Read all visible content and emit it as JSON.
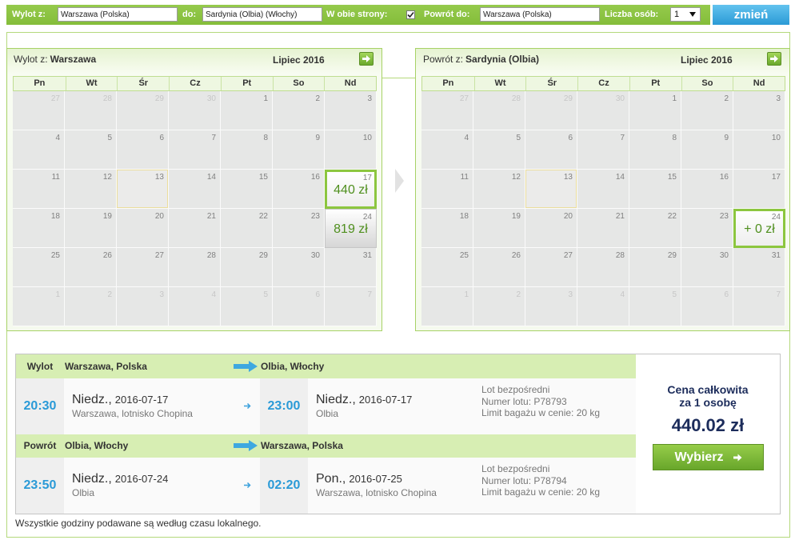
{
  "search": {
    "from_label": "Wylot z:",
    "from_value": "Warszawa (Polska)",
    "to_label": "do:",
    "to_value": "Sardynia (Olbia) (Włochy)",
    "roundtrip_label": "W obie strony:",
    "roundtrip_checked": true,
    "return_label": "Powrót do:",
    "return_value": "Warszawa (Polska)",
    "persons_label": "Liczba osób:",
    "persons_value": "1",
    "submit_label": "zmień"
  },
  "calendars": [
    {
      "title_prefix": "Wylot z:",
      "title_city": "Warszawa",
      "month": "Lipiec 2016",
      "weekdays": [
        "Pn",
        "Wt",
        "Śr",
        "Cz",
        "Pt",
        "So",
        "Nd"
      ],
      "weeks": [
        [
          {
            "d": "27",
            "other": true
          },
          {
            "d": "28",
            "other": true
          },
          {
            "d": "29",
            "other": true
          },
          {
            "d": "30",
            "other": true
          },
          {
            "d": "1"
          },
          {
            "d": "2"
          },
          {
            "d": "3"
          }
        ],
        [
          {
            "d": "4"
          },
          {
            "d": "5"
          },
          {
            "d": "6"
          },
          {
            "d": "7"
          },
          {
            "d": "8"
          },
          {
            "d": "9"
          },
          {
            "d": "10"
          }
        ],
        [
          {
            "d": "11"
          },
          {
            "d": "12"
          },
          {
            "d": "13",
            "today": true
          },
          {
            "d": "14"
          },
          {
            "d": "15"
          },
          {
            "d": "16"
          },
          {
            "d": "17",
            "price": "440 zł",
            "selected": true
          }
        ],
        [
          {
            "d": "18"
          },
          {
            "d": "19"
          },
          {
            "d": "20"
          },
          {
            "d": "21"
          },
          {
            "d": "22"
          },
          {
            "d": "23"
          },
          {
            "d": "24",
            "price": "819 zł"
          }
        ],
        [
          {
            "d": "25"
          },
          {
            "d": "26"
          },
          {
            "d": "27"
          },
          {
            "d": "28"
          },
          {
            "d": "29"
          },
          {
            "d": "30"
          },
          {
            "d": "31"
          }
        ],
        [
          {
            "d": "1",
            "other": true
          },
          {
            "d": "2",
            "other": true
          },
          {
            "d": "3",
            "other": true
          },
          {
            "d": "4",
            "other": true
          },
          {
            "d": "5",
            "other": true
          },
          {
            "d": "6",
            "other": true
          },
          {
            "d": "7",
            "other": true
          }
        ]
      ]
    },
    {
      "title_prefix": "Powrót z:",
      "title_city": "Sardynia (Olbia)",
      "month": "Lipiec 2016",
      "weekdays": [
        "Pn",
        "Wt",
        "Śr",
        "Cz",
        "Pt",
        "So",
        "Nd"
      ],
      "weeks": [
        [
          {
            "d": "27",
            "other": true
          },
          {
            "d": "28",
            "other": true
          },
          {
            "d": "29",
            "other": true
          },
          {
            "d": "30",
            "other": true
          },
          {
            "d": "1"
          },
          {
            "d": "2"
          },
          {
            "d": "3"
          }
        ],
        [
          {
            "d": "4"
          },
          {
            "d": "5"
          },
          {
            "d": "6"
          },
          {
            "d": "7"
          },
          {
            "d": "8"
          },
          {
            "d": "9"
          },
          {
            "d": "10"
          }
        ],
        [
          {
            "d": "11"
          },
          {
            "d": "12"
          },
          {
            "d": "13",
            "today": true
          },
          {
            "d": "14"
          },
          {
            "d": "15"
          },
          {
            "d": "16"
          },
          {
            "d": "17"
          }
        ],
        [
          {
            "d": "18"
          },
          {
            "d": "19"
          },
          {
            "d": "20"
          },
          {
            "d": "21"
          },
          {
            "d": "22"
          },
          {
            "d": "23"
          },
          {
            "d": "24",
            "price": "+ 0 zł",
            "selected": true
          }
        ],
        [
          {
            "d": "25"
          },
          {
            "d": "26"
          },
          {
            "d": "27"
          },
          {
            "d": "28"
          },
          {
            "d": "29"
          },
          {
            "d": "30"
          },
          {
            "d": "31"
          }
        ],
        [
          {
            "d": "1",
            "other": true
          },
          {
            "d": "2",
            "other": true
          },
          {
            "d": "3",
            "other": true
          },
          {
            "d": "4",
            "other": true
          },
          {
            "d": "5",
            "other": true
          },
          {
            "d": "6",
            "other": true
          },
          {
            "d": "7",
            "other": true
          }
        ]
      ]
    }
  ],
  "flights": {
    "legs": [
      {
        "label": "Wylot",
        "from": "Warszawa, Polska",
        "to": "Olbia, Włochy",
        "departure": {
          "time": "20:30",
          "day": "Niedz.,",
          "date": "2016-07-17",
          "place": "Warszawa, lotnisko Chopina"
        },
        "arrival": {
          "time": "23:00",
          "day": "Niedz.,",
          "date": "2016-07-17",
          "place": "Olbia"
        },
        "info": [
          "Lot bezpośredni",
          "Numer lotu: P78793",
          "Limit bagażu w cenie: 20 kg"
        ]
      },
      {
        "label": "Powrót",
        "from": "Olbia, Włochy",
        "to": "Warszawa, Polska",
        "departure": {
          "time": "23:50",
          "day": "Niedz.,",
          "date": "2016-07-24",
          "place": "Olbia"
        },
        "arrival": {
          "time": "02:20",
          "day": "Pon.,",
          "date": "2016-07-25",
          "place": "Warszawa, lotnisko Chopina"
        },
        "info": [
          "Lot bezpośredni",
          "Numer lotu: P78794",
          "Limit bagażu w cenie: 20 kg"
        ]
      }
    ]
  },
  "price": {
    "title": "Cena całkowita",
    "subtitle": "za 1 osobę",
    "amount": "440.02 zł",
    "button": "Wybierz"
  },
  "footer_note": "Wszystkie godziny podawane są według czasu lokalnego.",
  "icons": {
    "next_month": "arrow-right-icon",
    "route": "arrow-right-icon",
    "between_calendars": "chevron-right-icon",
    "checkbox": "check-icon",
    "dropdown": "triangle-down-icon"
  },
  "colors": {
    "brand_green": "#8cc63f",
    "header_green": "#d7eeb3",
    "accent_blue": "#2a9ad7",
    "price_green": "#4f8f1e",
    "navy": "#1c2c5b"
  }
}
